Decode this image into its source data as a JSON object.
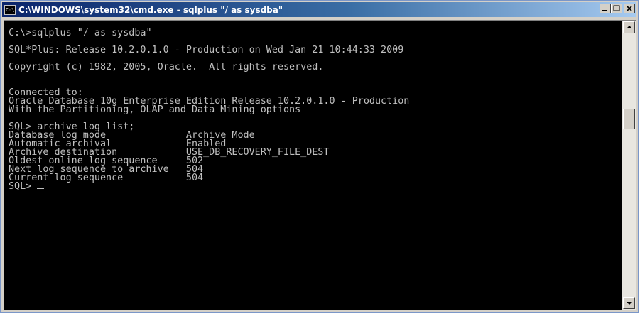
{
  "window": {
    "title": "C:\\WINDOWS\\system32\\cmd.exe - sqlplus \"/ as sysdba\"",
    "icon_text": "C:\\",
    "accent_color": "#0a246a",
    "buttons": [
      "minimize-icon",
      "maximize-icon",
      "close-icon"
    ]
  },
  "console": {
    "lines": [
      "C:\\>sqlplus \"/ as sysdba\"",
      "",
      "SQL*Plus: Release 10.2.0.1.0 - Production on Wed Jan 21 10:44:33 2009",
      "",
      "Copyright (c) 1982, 2005, Oracle.  All rights reserved.",
      "",
      "",
      "Connected to:",
      "Oracle Database 10g Enterprise Edition Release 10.2.0.1.0 - Production",
      "With the Partitioning, OLAP and Data Mining options",
      "",
      "SQL> archive log list;",
      "Database log mode              Archive Mode",
      "Automatic archival             Enabled",
      "Archive destination            USE_DB_RECOVERY_FILE_DEST",
      "Oldest online log sequence     502",
      "Next log sequence to archive   504",
      "Current log sequence           504"
    ],
    "prompt": "SQL> ",
    "text_color": "#c0c0c0",
    "background_color": "#000000"
  },
  "scrollbar": {
    "up_icon": "scroll-up-arrow-icon",
    "down_icon": "scroll-down-arrow-icon"
  }
}
